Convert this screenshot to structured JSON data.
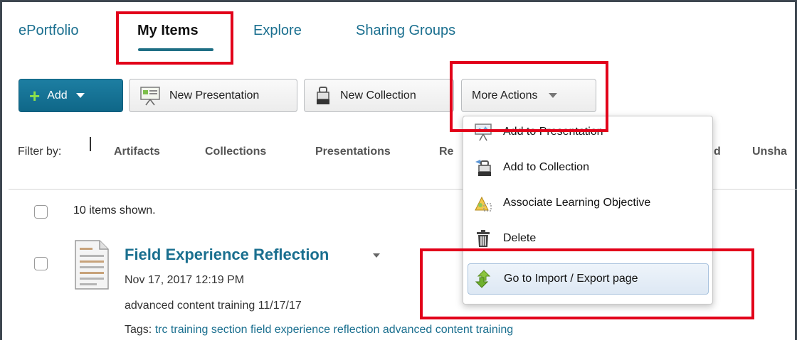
{
  "tabs": [
    {
      "label": "ePortfolio"
    },
    {
      "label": "My Items"
    },
    {
      "label": "Explore"
    },
    {
      "label": "Sharing Groups"
    }
  ],
  "toolbar": {
    "add_label": "Add",
    "new_presentation_label": "New Presentation",
    "new_collection_label": "New Collection",
    "more_actions_label": "More Actions"
  },
  "filter": {
    "label": "Filter by:",
    "options": [
      "Artifacts",
      "Collections",
      "Presentations",
      "Re",
      "d",
      "Unsha"
    ]
  },
  "list": {
    "count_text": "10 items shown.",
    "items": [
      {
        "title": "Field Experience Reflection",
        "date": "Nov 17, 2017 12:19 PM",
        "description": "advanced content training 11/17/17",
        "tags_label": "Tags:",
        "tags": "trc training section field experience reflection advanced content training"
      }
    ]
  },
  "menu": {
    "items": [
      {
        "label": "Add to Presentation",
        "icon": "presentation-icon"
      },
      {
        "label": "Add to Collection",
        "icon": "collection-icon"
      },
      {
        "label": "Associate Learning Objective",
        "icon": "learning-objective-icon"
      },
      {
        "label": "Delete",
        "icon": "trash-icon"
      },
      {
        "label": "Go to Import / Export page",
        "icon": "import-export-icon",
        "selected": true
      }
    ]
  },
  "colors": {
    "accent": "#1a6f8f",
    "add_button": "#137399",
    "highlight": "#e2001a"
  }
}
